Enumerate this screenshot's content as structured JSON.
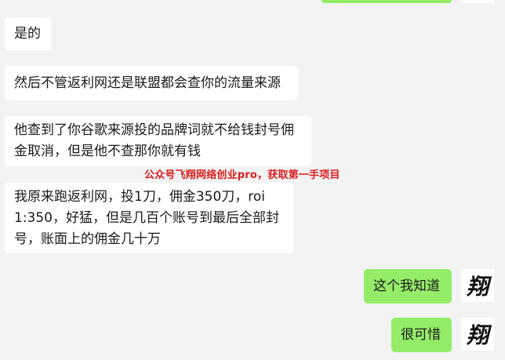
{
  "colors": {
    "background": "#f3f3f3",
    "incoming_bubble": "#ffffff",
    "outgoing_bubble": "#95ec69",
    "watermark": "#d81e1e"
  },
  "messages": [
    {
      "side": "incoming",
      "text": "是的"
    },
    {
      "side": "incoming",
      "text": "然后不管返利网还是联盟都会查你的流量来源"
    },
    {
      "side": "incoming",
      "lines": [
        "他查到了你谷歌来源投的品牌词就不给钱封号佣",
        "金取消，但是他不查那你就有钱"
      ]
    },
    {
      "side": "incoming",
      "lines": [
        "我原来跑返利网，投1刀，佣金350刀，roi",
        "1:350，好猛，但是几百个账号到最后全部封",
        "号，账面上的佣金几十万"
      ]
    },
    {
      "side": "outgoing",
      "text": "这个我知道"
    },
    {
      "side": "outgoing",
      "text": "很可惜"
    }
  ],
  "watermark": "公众号飞翔网络创业pro，获取第一手项目",
  "avatar": {
    "glyph": "翔",
    "icon": "user-avatar-icon"
  }
}
